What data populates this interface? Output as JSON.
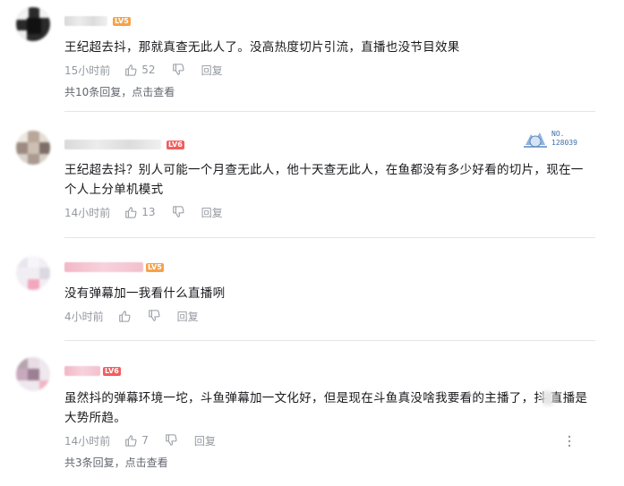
{
  "comments": [
    {
      "level": "LV5",
      "level_color": "#f6a24a",
      "content": "王纪超去抖，那就真查无此人了。没高热度切片引流，直播也没节目效果",
      "time": "15小时前",
      "likes": "52",
      "reply_label": "回复",
      "replies_text": "共10条回复，点击查看"
    },
    {
      "level": "LV6",
      "level_color": "#f25d5d",
      "content": "王纪超去抖？别人可能一个月查无此人，他十天查无此人，在鱼都没有多少好看的切片，现在一个人上分单机模式",
      "time": "14小时前",
      "likes": "13",
      "reply_label": "回复",
      "badge_text": "NO.\n128039"
    },
    {
      "level": "LV5",
      "level_color": "#f6a24a",
      "content": "没有弹幕加一我看什么直播咧",
      "time": "4小时前",
      "likes": "",
      "reply_label": "回复"
    },
    {
      "level": "LV6",
      "level_color": "#f25d5d",
      "content": "虽然抖的弹幕环境一坨，斗鱼弹幕加一文化好，但是现在斗鱼真没啥我要看的主播了，抖    直播是大势所趋。",
      "time": "14小时前",
      "likes": "7",
      "reply_label": "回复",
      "more_icon": "more-vertical-icon",
      "replies_text": "共3条回复，点击查看"
    }
  ],
  "icons": {
    "like": "thumbs-up-icon",
    "dislike": "thumbs-down-icon"
  }
}
